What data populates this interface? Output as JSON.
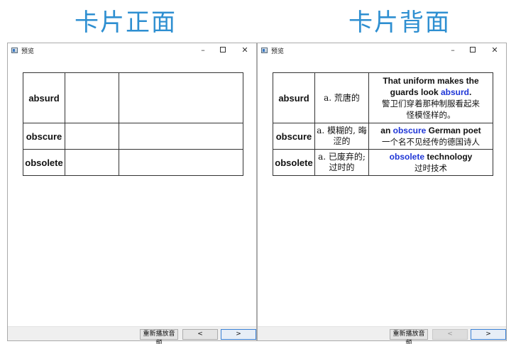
{
  "headings": {
    "front": "卡片正面",
    "back": "卡片背面"
  },
  "window": {
    "title": "预览",
    "minimize": "–",
    "close": "✕"
  },
  "buttons": {
    "replay": "重新播放音频",
    "prev": "<",
    "next": ">"
  },
  "cards": [
    {
      "word": "absurd",
      "meaning": "a. 荒唐的",
      "example": {
        "before": "That uniform makes the guards look ",
        "highlight": "absurd",
        "after": ".",
        "translation_lines": [
          "警卫们穿着那种制服看起来",
          "怪模怪样的。"
        ]
      }
    },
    {
      "word": "obscure",
      "meaning": "a. 模糊的, 晦涩的",
      "example": {
        "before": "an ",
        "highlight": "obscure",
        "after": " German poet",
        "translation_lines": [
          "一个名不见经传的德国诗人"
        ]
      }
    },
    {
      "word": "obsolete",
      "meaning": "a. 已废弃的; 过时的",
      "example": {
        "before": "",
        "highlight": "obsolete",
        "after": " technology",
        "translation_lines": [
          "过时技术"
        ]
      }
    }
  ],
  "colors": {
    "heading": "#2e8fd1",
    "highlight": "#1f36d6"
  },
  "state": {
    "front_prev_enabled": true,
    "back_prev_enabled": false
  }
}
